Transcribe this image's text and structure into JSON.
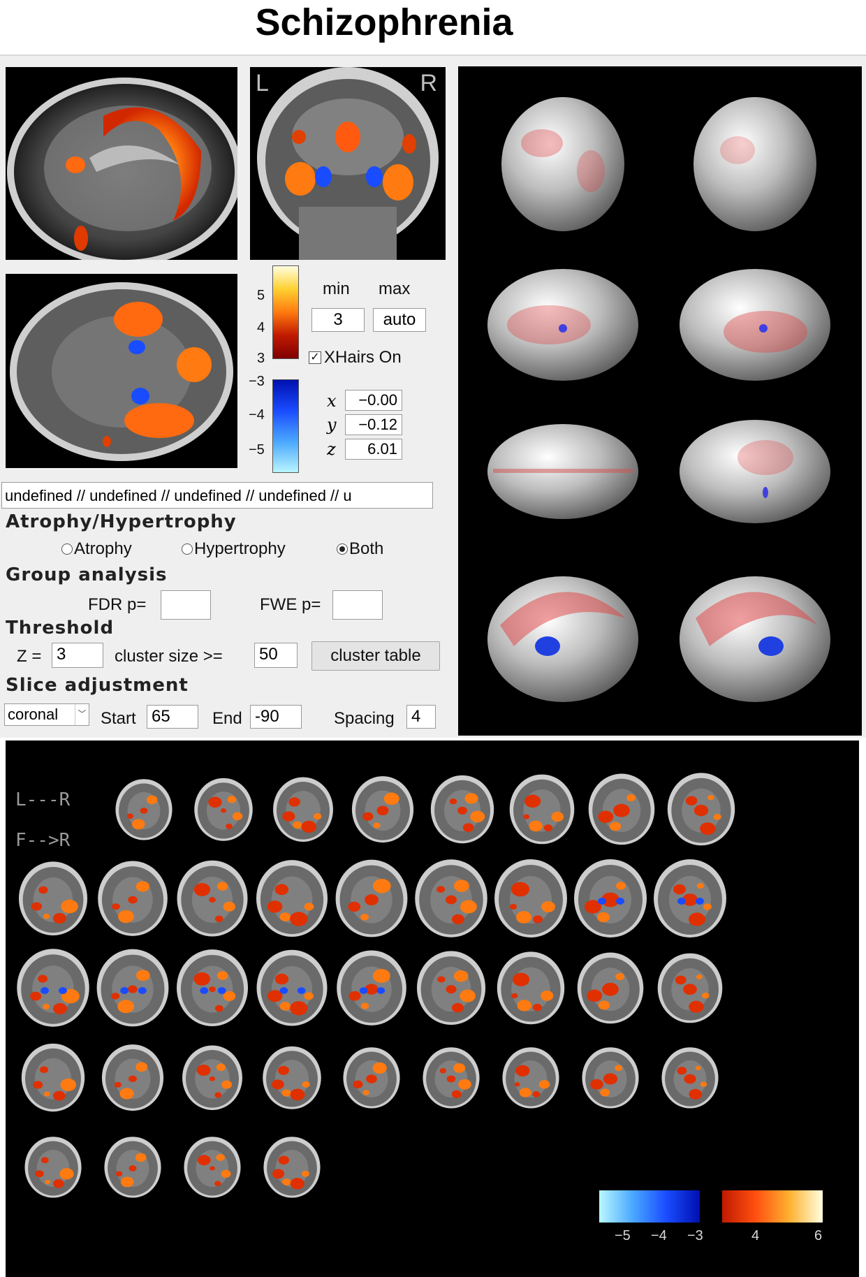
{
  "title": "Schizophrenia",
  "views": {
    "coronal_left_label": "L",
    "coronal_right_label": "R"
  },
  "colorbar": {
    "positive_ticks": [
      "5",
      "4",
      "3"
    ],
    "negative_ticks": [
      "−3",
      "−4",
      "−5"
    ]
  },
  "controls": {
    "min_label": "min",
    "max_label": "max",
    "min_value": "3",
    "max_value": "auto",
    "xhairs_label": "XHairs On",
    "xhairs_checked": true,
    "coords": {
      "x_label": "x",
      "x_value": "−0.00",
      "y_label": "y",
      "y_value": "−0.12",
      "z_label": "z",
      "z_value": "6.01"
    },
    "location_text": "undefined // undefined // undefined // undefined // u"
  },
  "atrophy": {
    "heading": "Atrophy/Hypertrophy",
    "options": [
      "Atrophy",
      "Hypertrophy",
      "Both"
    ],
    "selected": "Both"
  },
  "group": {
    "heading": "Group analysis",
    "fdr_label": "FDR p=",
    "fdr_value": "",
    "fwe_label": "FWE p=",
    "fwe_value": ""
  },
  "threshold": {
    "heading": "Threshold",
    "z_label": "Z =",
    "z_value": "3",
    "cluster_label": "cluster size >=",
    "cluster_value": "50",
    "cluster_button": "cluster table"
  },
  "slice_adjust": {
    "heading": "Slice adjustment",
    "orientation": "coronal",
    "start_label": "Start",
    "start_value": "65",
    "end_label": "End",
    "end_value": "-90",
    "spacing_label": "Spacing",
    "spacing_value": "4"
  },
  "slice_panel": {
    "hint_lr": "L---R",
    "hint_fr": "F-->R",
    "slice_count": 40,
    "legend_neg_ticks": [
      "−5",
      "−4",
      "−3"
    ],
    "legend_pos_ticks": [
      "4",
      "6"
    ]
  },
  "colors": {
    "panel_bg": "#efefef",
    "hot_low": "#c81e00",
    "hot_high": "#ffffd0",
    "cold_low": "#0018c0",
    "cold_high": "#a8f0ff"
  }
}
